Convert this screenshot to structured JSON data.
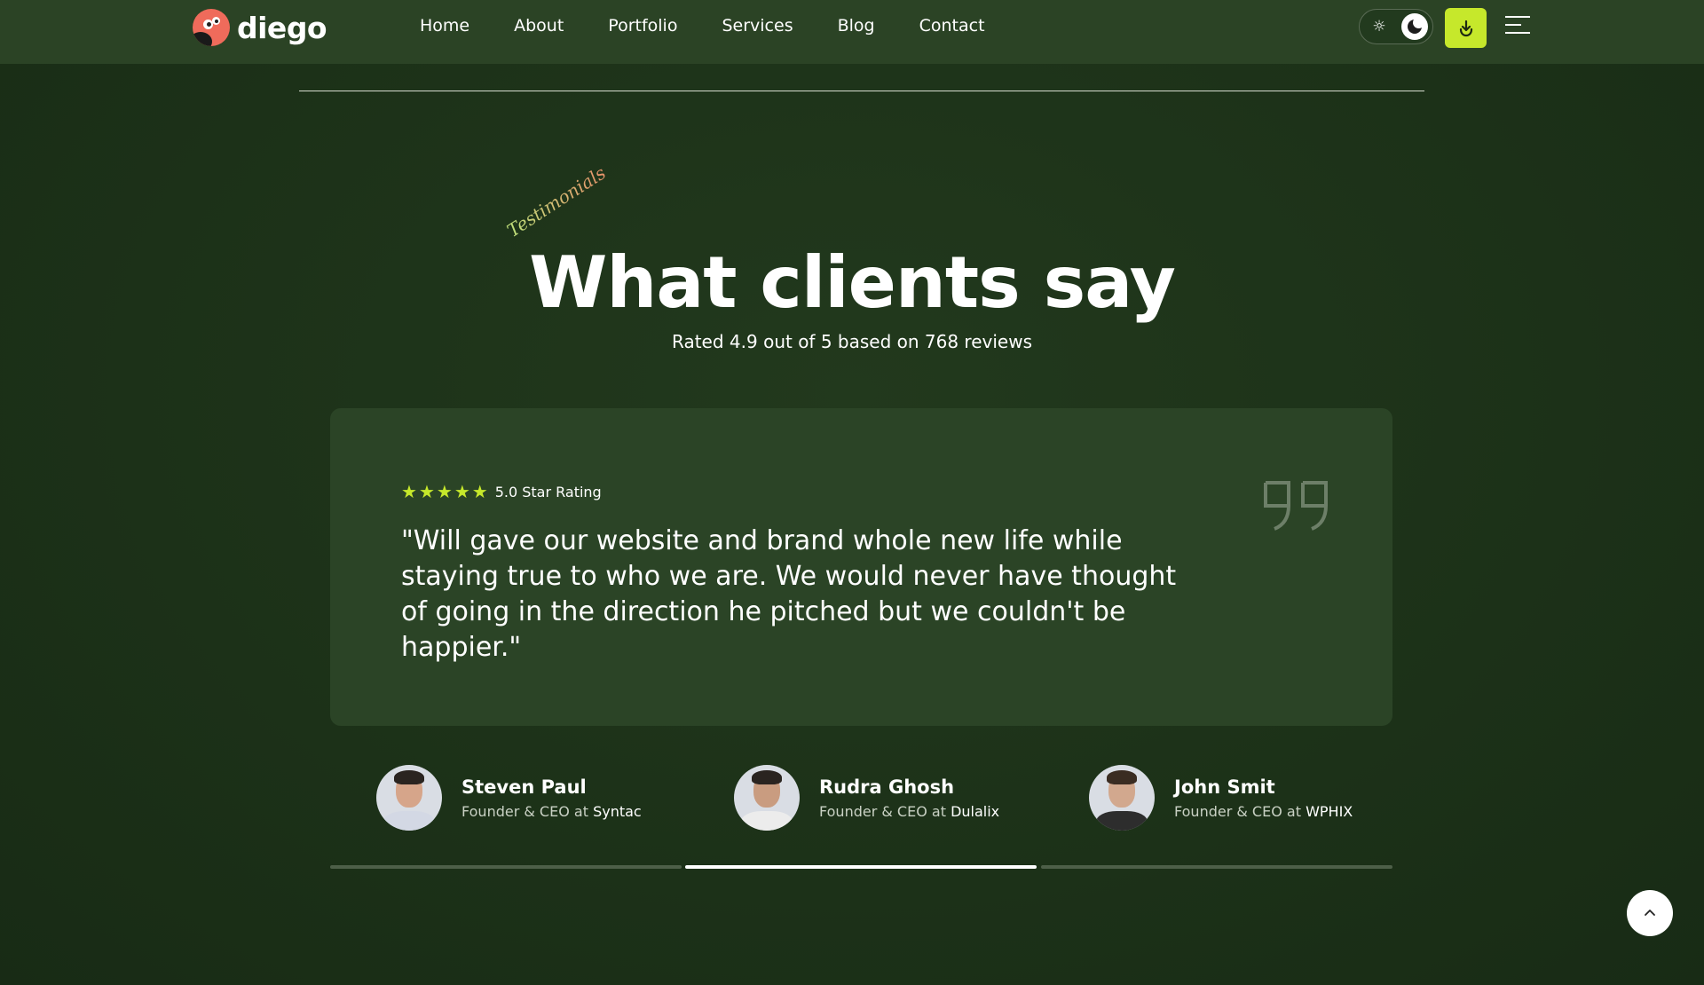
{
  "brand": {
    "name": "diego"
  },
  "nav": [
    {
      "label": "Home"
    },
    {
      "label": "About"
    },
    {
      "label": "Portfolio"
    },
    {
      "label": "Services"
    },
    {
      "label": "Blog"
    },
    {
      "label": "Contact"
    }
  ],
  "header_icons": {
    "theme_toggle": [
      "sun-icon",
      "moon-icon"
    ],
    "download": "download-icon",
    "menu": "menu-icon"
  },
  "section": {
    "eyebrow": "Testimonials",
    "title": "What clients say",
    "subtitle": "Rated 4.9 out of 5 based on 768 reviews"
  },
  "testimonial": {
    "stars": 5,
    "rating_label": "5.0 Star Rating",
    "quote": "\"Will gave our website and brand whole new life while staying true to who we are. We would never have thought of going in the direction he pitched but we couldn't be happier.\""
  },
  "clients": [
    {
      "name": "Steven Paul",
      "role": "Founder & CEO at",
      "company": "Syntac"
    },
    {
      "name": "Rudra Ghosh",
      "role": "Founder & CEO at",
      "company": "Dulalix"
    },
    {
      "name": "John Smit",
      "role": "Founder & CEO at",
      "company": "WPHIX"
    }
  ],
  "slider": {
    "active_index": 1,
    "count": 3
  },
  "colors": {
    "accent": "#c6e82b",
    "background": "#1d3319",
    "card": "#2b4426",
    "header": "#2b4325"
  }
}
